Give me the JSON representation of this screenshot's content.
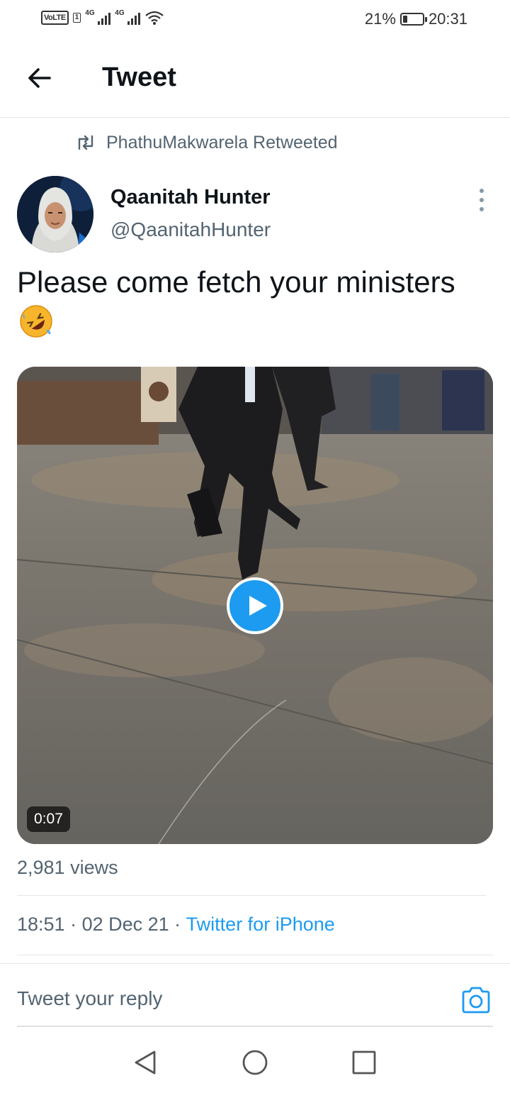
{
  "status_bar": {
    "volte": "VoLTE",
    "sim": "1",
    "net1": "4G",
    "net2": "4G",
    "battery_percent": "21%",
    "time": "20:31"
  },
  "header": {
    "title": "Tweet"
  },
  "retweet": {
    "text": "PhathuMakwarela Retweeted"
  },
  "author": {
    "name": "Qaanitah Hunter",
    "handle": "@QaanitahHunter"
  },
  "tweet": {
    "text": "Please come fetch your ministers",
    "emoji": "rolling-on-the-floor-laughing-emoji"
  },
  "media": {
    "duration": "0:07"
  },
  "stats": {
    "views": "2,981 views"
  },
  "meta": {
    "time": "18:51",
    "sep1": " · ",
    "date": "02 Dec 21",
    "sep2": " · ",
    "source": "Twitter for iPhone"
  },
  "reply": {
    "placeholder": "Tweet your reply"
  },
  "colors": {
    "accent": "#1d9bf0",
    "secondary_text": "#536471",
    "primary_text": "#0f1419"
  },
  "icons": {
    "back": "arrow-left-icon",
    "retweet": "retweet-icon",
    "more": "more-vertical-icon",
    "play": "play-icon",
    "camera": "camera-icon",
    "nav_back": "triangle-back-icon",
    "nav_home": "circle-home-icon",
    "nav_recents": "square-recents-icon"
  }
}
